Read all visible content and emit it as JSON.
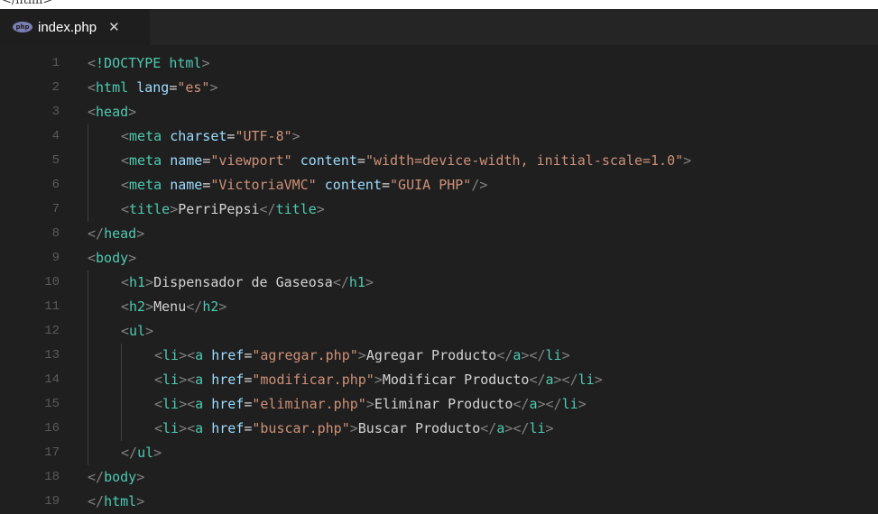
{
  "top_fragment": "</html>",
  "tab": {
    "label": "index.php",
    "icon": "php-icon",
    "close": "✕"
  },
  "lines": [
    {
      "n": "1",
      "indent": 0,
      "tokens": [
        [
          "p",
          "<"
        ],
        [
          "d",
          "!DOCTYPE"
        ],
        [
          "x",
          " "
        ],
        [
          "t",
          "html"
        ],
        [
          "p",
          ">"
        ]
      ]
    },
    {
      "n": "2",
      "indent": 0,
      "tokens": [
        [
          "p",
          "<"
        ],
        [
          "t",
          "html"
        ],
        [
          "x",
          " "
        ],
        [
          "a",
          "lang"
        ],
        [
          "x",
          "="
        ],
        [
          "s",
          "\"es\""
        ],
        [
          "p",
          ">"
        ]
      ]
    },
    {
      "n": "3",
      "indent": 0,
      "tokens": [
        [
          "p",
          "<"
        ],
        [
          "t",
          "head"
        ],
        [
          "p",
          ">"
        ]
      ]
    },
    {
      "n": "4",
      "indent": 1,
      "tokens": [
        [
          "p",
          "<"
        ],
        [
          "t",
          "meta"
        ],
        [
          "x",
          " "
        ],
        [
          "a",
          "charset"
        ],
        [
          "x",
          "="
        ],
        [
          "s",
          "\"UTF-8\""
        ],
        [
          "p",
          ">"
        ]
      ]
    },
    {
      "n": "5",
      "indent": 1,
      "tokens": [
        [
          "p",
          "<"
        ],
        [
          "t",
          "meta"
        ],
        [
          "x",
          " "
        ],
        [
          "a",
          "name"
        ],
        [
          "x",
          "="
        ],
        [
          "s",
          "\"viewport\""
        ],
        [
          "x",
          " "
        ],
        [
          "a",
          "content"
        ],
        [
          "x",
          "="
        ],
        [
          "s",
          "\"width=device-width, initial-scale=1.0\""
        ],
        [
          "p",
          ">"
        ]
      ]
    },
    {
      "n": "6",
      "indent": 1,
      "tokens": [
        [
          "p",
          "<"
        ],
        [
          "t",
          "meta"
        ],
        [
          "x",
          " "
        ],
        [
          "a",
          "name"
        ],
        [
          "x",
          "="
        ],
        [
          "s",
          "\"VictoriaVMC\""
        ],
        [
          "x",
          " "
        ],
        [
          "a",
          "content"
        ],
        [
          "x",
          "="
        ],
        [
          "s",
          "\"GUIA PHP\""
        ],
        [
          "p",
          "/>"
        ]
      ]
    },
    {
      "n": "7",
      "indent": 1,
      "tokens": [
        [
          "p",
          "<"
        ],
        [
          "t",
          "title"
        ],
        [
          "p",
          ">"
        ],
        [
          "x",
          "PerriPepsi"
        ],
        [
          "p",
          "</"
        ],
        [
          "t",
          "title"
        ],
        [
          "p",
          ">"
        ]
      ]
    },
    {
      "n": "8",
      "indent": 0,
      "tokens": [
        [
          "p",
          "</"
        ],
        [
          "t",
          "head"
        ],
        [
          "p",
          ">"
        ]
      ]
    },
    {
      "n": "9",
      "indent": 0,
      "tokens": [
        [
          "p",
          "<"
        ],
        [
          "t",
          "body"
        ],
        [
          "p",
          ">"
        ]
      ]
    },
    {
      "n": "10",
      "indent": 1,
      "tokens": [
        [
          "p",
          "<"
        ],
        [
          "t",
          "h1"
        ],
        [
          "p",
          ">"
        ],
        [
          "x",
          "Dispensador de Gaseosa"
        ],
        [
          "p",
          "</"
        ],
        [
          "t",
          "h1"
        ],
        [
          "p",
          ">"
        ]
      ]
    },
    {
      "n": "11",
      "indent": 1,
      "tokens": [
        [
          "p",
          "<"
        ],
        [
          "t",
          "h2"
        ],
        [
          "p",
          ">"
        ],
        [
          "x",
          "Menu"
        ],
        [
          "p",
          "</"
        ],
        [
          "t",
          "h2"
        ],
        [
          "p",
          ">"
        ]
      ]
    },
    {
      "n": "12",
      "indent": 1,
      "tokens": [
        [
          "p",
          "<"
        ],
        [
          "t",
          "ul"
        ],
        [
          "p",
          ">"
        ]
      ]
    },
    {
      "n": "13",
      "indent": 2,
      "tokens": [
        [
          "p",
          "<"
        ],
        [
          "t",
          "li"
        ],
        [
          "p",
          "><"
        ],
        [
          "t",
          "a"
        ],
        [
          "x",
          " "
        ],
        [
          "a",
          "href"
        ],
        [
          "x",
          "="
        ],
        [
          "s",
          "\"agregar.php\""
        ],
        [
          "p",
          ">"
        ],
        [
          "x",
          "Agregar Producto"
        ],
        [
          "p",
          "</"
        ],
        [
          "t",
          "a"
        ],
        [
          "p",
          "></"
        ],
        [
          "t",
          "li"
        ],
        [
          "p",
          ">"
        ]
      ]
    },
    {
      "n": "14",
      "indent": 2,
      "tokens": [
        [
          "p",
          "<"
        ],
        [
          "t",
          "li"
        ],
        [
          "p",
          "><"
        ],
        [
          "t",
          "a"
        ],
        [
          "x",
          " "
        ],
        [
          "a",
          "href"
        ],
        [
          "x",
          "="
        ],
        [
          "s",
          "\"modificar.php\""
        ],
        [
          "p",
          ">"
        ],
        [
          "x",
          "Modificar Producto"
        ],
        [
          "p",
          "</"
        ],
        [
          "t",
          "a"
        ],
        [
          "p",
          "></"
        ],
        [
          "t",
          "li"
        ],
        [
          "p",
          ">"
        ]
      ]
    },
    {
      "n": "15",
      "indent": 2,
      "tokens": [
        [
          "p",
          "<"
        ],
        [
          "t",
          "li"
        ],
        [
          "p",
          "><"
        ],
        [
          "t",
          "a"
        ],
        [
          "x",
          " "
        ],
        [
          "a",
          "href"
        ],
        [
          "x",
          "="
        ],
        [
          "s",
          "\"eliminar.php\""
        ],
        [
          "p",
          ">"
        ],
        [
          "x",
          "Eliminar Producto"
        ],
        [
          "p",
          "</"
        ],
        [
          "t",
          "a"
        ],
        [
          "p",
          "></"
        ],
        [
          "t",
          "li"
        ],
        [
          "p",
          ">"
        ]
      ]
    },
    {
      "n": "16",
      "indent": 2,
      "tokens": [
        [
          "p",
          "<"
        ],
        [
          "t",
          "li"
        ],
        [
          "p",
          "><"
        ],
        [
          "t",
          "a"
        ],
        [
          "x",
          " "
        ],
        [
          "a",
          "href"
        ],
        [
          "x",
          "="
        ],
        [
          "s",
          "\"buscar.php\""
        ],
        [
          "p",
          ">"
        ],
        [
          "x",
          "Buscar Producto"
        ],
        [
          "p",
          "</"
        ],
        [
          "t",
          "a"
        ],
        [
          "p",
          "></"
        ],
        [
          "t",
          "li"
        ],
        [
          "p",
          ">"
        ]
      ]
    },
    {
      "n": "17",
      "indent": 1,
      "tokens": [
        [
          "p",
          "</"
        ],
        [
          "t",
          "ul"
        ],
        [
          "p",
          ">"
        ]
      ]
    },
    {
      "n": "18",
      "indent": 0,
      "tokens": [
        [
          "p",
          "</"
        ],
        [
          "t",
          "body"
        ],
        [
          "p",
          ">"
        ]
      ]
    },
    {
      "n": "19",
      "indent": 0,
      "tokens": [
        [
          "p",
          "</"
        ],
        [
          "t",
          "html"
        ],
        [
          "p",
          ">"
        ]
      ]
    }
  ]
}
